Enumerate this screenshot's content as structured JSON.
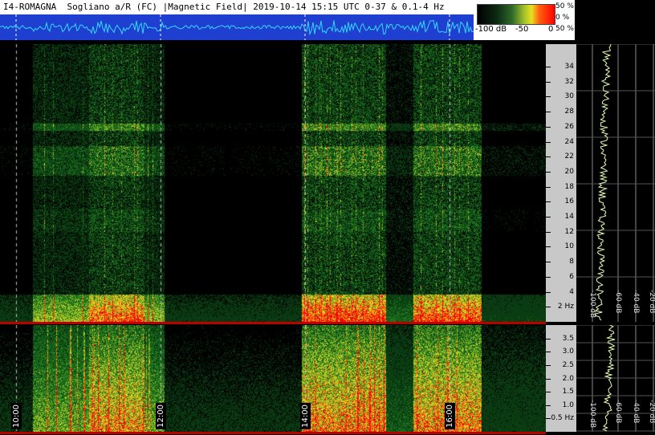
{
  "header": {
    "title": "I4-ROMAGNA  Sogliano a/R (FC) |Magnetic Field| 2019-10-14 15:15 UTC 0-37 & 0.1-4 Hz"
  },
  "scale": {
    "left_label": "-100 dB",
    "mid_label": "-50",
    "right_label": "0",
    "percent_labels": [
      "50 %",
      "0 %",
      "50 %"
    ]
  },
  "chart_data": [
    {
      "type": "heatmap",
      "title": "",
      "ylabel": "",
      "ylim": [
        0,
        37
      ],
      "y_ticks": [
        "2 Hz",
        "4",
        "6",
        "8",
        "10",
        "12",
        "14",
        "16",
        "18",
        "20",
        "22",
        "24",
        "26",
        "28",
        "30",
        "32",
        "34"
      ],
      "x_ticks": [
        "10:00",
        "12:00",
        "14:00",
        "16:00"
      ],
      "side_spectrum_ticks": [
        "-100 dB",
        "-60 dB",
        "-40 dB",
        "-20 dB"
      ]
    },
    {
      "type": "heatmap",
      "title": "",
      "ylabel": "",
      "ylim": [
        0.1,
        4
      ],
      "y_ticks": [
        "0.5 Hz",
        "1.0",
        "1.5",
        "2.0",
        "2.5",
        "3.0",
        "3.5"
      ],
      "side_spectrum_ticks": [
        "-100 dB",
        "-60 dB",
        "-40 dB",
        "-20 dB"
      ]
    }
  ],
  "colors": {
    "background": "#000000",
    "waveform_bg": "#1f3fd0",
    "waveform_line": "#33d9ff",
    "accent_red": "#ff0000",
    "accent_yellow": "#e8e020",
    "mid_green": "#2f6a2a"
  }
}
